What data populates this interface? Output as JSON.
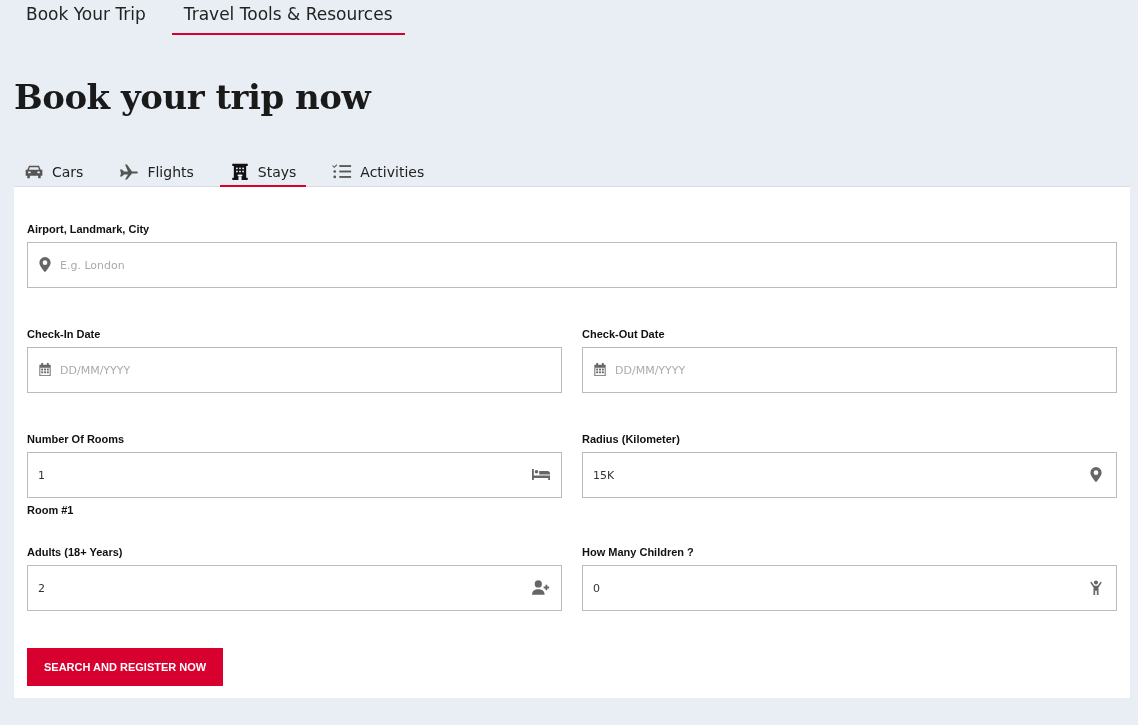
{
  "top_nav": [
    {
      "label": "Book Your Trip",
      "selected": false
    },
    {
      "label": "Travel Tools & Resources",
      "selected": true
    }
  ],
  "heading": "Book your trip now",
  "tabs": [
    {
      "label": "Cars",
      "kind": "car",
      "selected": false
    },
    {
      "label": "Flights",
      "kind": "plane",
      "selected": false
    },
    {
      "label": "Stays",
      "kind": "building",
      "selected": true
    },
    {
      "label": "Activities",
      "kind": "checklist",
      "selected": false
    }
  ],
  "form": {
    "rows": [
      {
        "kind": "fields",
        "fields": [
          {
            "label": "Airport, Landmark, City",
            "placeholder": "E.g. London",
            "kind": "location"
          }
        ]
      },
      {
        "kind": "fields",
        "fields": [
          {
            "label": "Check-In Date",
            "placeholder": "DD/MM/YYYY",
            "kind": "date"
          },
          {
            "label": "Check-Out Date",
            "placeholder": "DD/MM/YYYY",
            "kind": "date"
          }
        ]
      },
      {
        "kind": "fields",
        "fields": [
          {
            "label": "Number Of Rooms",
            "value": "1",
            "kind": "rooms"
          },
          {
            "label": "Radius (Kilometer)",
            "value": "15K",
            "kind": "radius"
          }
        ]
      },
      {
        "kind": "heading",
        "text": "Room #1"
      },
      {
        "kind": "fields",
        "fields": [
          {
            "label": "Adults (18+ Years)",
            "value": "2",
            "kind": "adults"
          },
          {
            "label": "How Many Children ?",
            "value": "0",
            "kind": "children"
          }
        ]
      }
    ],
    "submit": "SEARCH AND REGISTER NOW"
  }
}
